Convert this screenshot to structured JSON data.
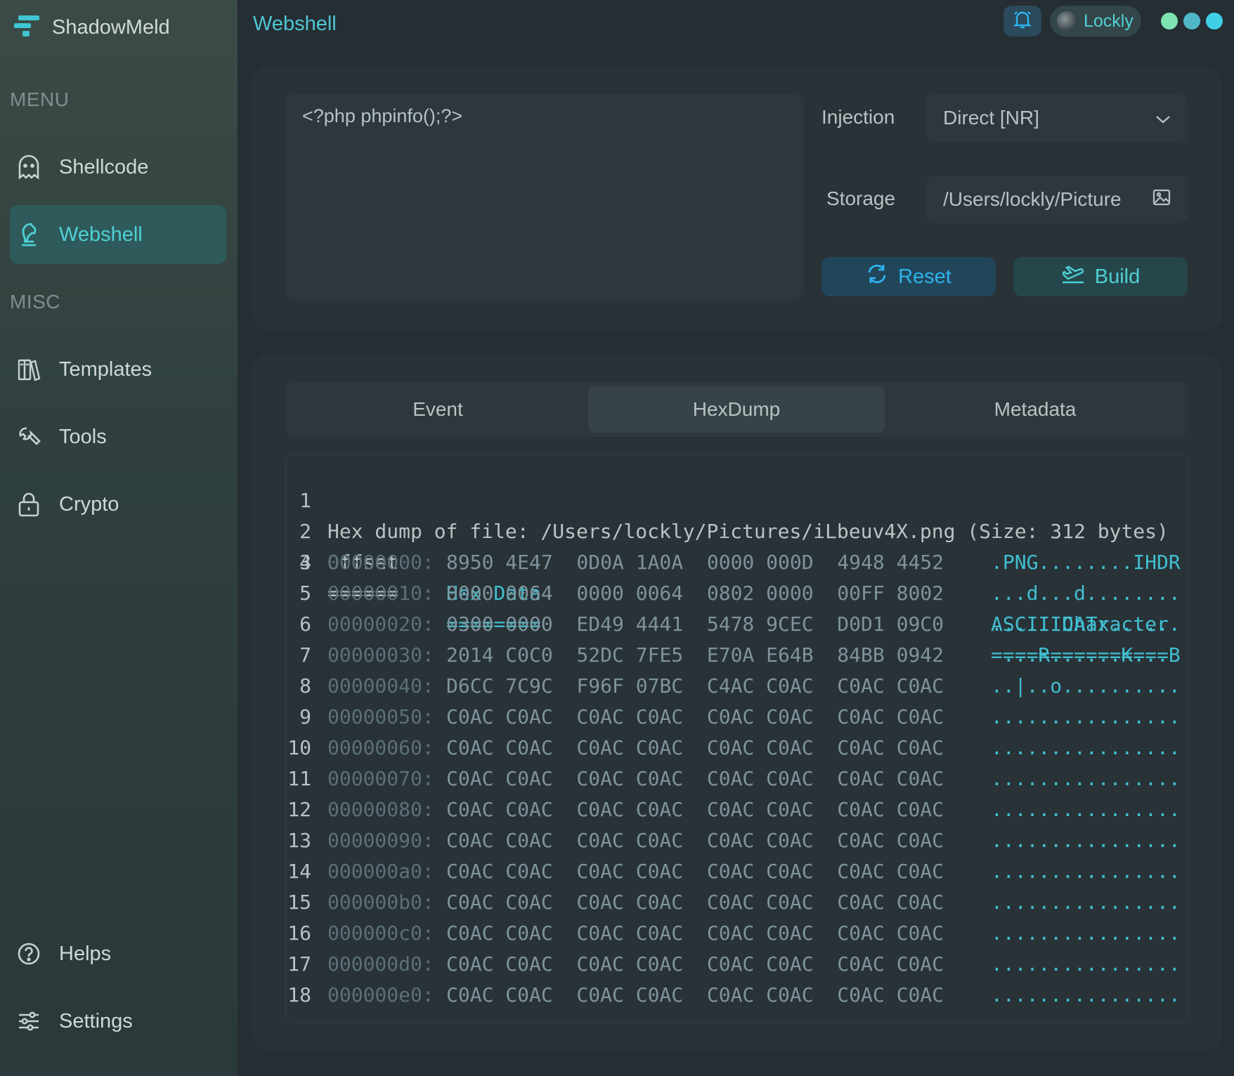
{
  "brand": {
    "name": "ShadowMeld"
  },
  "sidebar": {
    "menu_label": "MENU",
    "misc_label": "MISC",
    "items": [
      {
        "label": "Shellcode",
        "icon": "ghost-icon"
      },
      {
        "label": "Webshell",
        "icon": "chess-knight-icon",
        "active": true
      },
      {
        "label": "Templates",
        "icon": "books-icon"
      },
      {
        "label": "Tools",
        "icon": "wrench-icon"
      },
      {
        "label": "Crypto",
        "icon": "lock-icon"
      },
      {
        "label": "Helps",
        "icon": "help-circle-icon"
      },
      {
        "label": "Settings",
        "icon": "sliders-icon"
      }
    ]
  },
  "header": {
    "title": "Webshell",
    "user_name": "Lockly",
    "dot_colors": [
      "#7ee3b0",
      "#4fb7c8",
      "#3fd0e6"
    ]
  },
  "editor": {
    "code": "<?php phpinfo();?>"
  },
  "form": {
    "injection_label": "Injection",
    "injection_value": "Direct [NR]",
    "storage_label": "Storage",
    "storage_value": "/Users/lockly/Picture"
  },
  "actions": {
    "reset_label": "Reset",
    "build_label": "Build"
  },
  "tabs": [
    {
      "label": "Event"
    },
    {
      "label": "HexDump",
      "active": true
    },
    {
      "label": "Metadata"
    }
  ],
  "hexdump": {
    "header_line": "Hex dump of file: /Users/lockly/Pictures/iLbeuv4X.png (Size: 312 bytes)",
    "col_offset": "Offset",
    "col_hex": "Hex Data",
    "col_ascii": "ASCII Character",
    "sep_offset": "======",
    "sep_hex": "========",
    "sep_ascii": "===============",
    "rows": [
      {
        "offset": "00000000:",
        "hex": "8950 4E47  0D0A 1A0A  0000 000D  4948 4452",
        "ascii": ".PNG........IHDR"
      },
      {
        "offset": "00000010:",
        "hex": "0000 0064  0000 0064  0802 0000  00FF 8002",
        "ascii": "...d...d........"
      },
      {
        "offset": "00000020:",
        "hex": "0300 0000  ED49 4441  5478 9CEC  D0D1 09C0",
        "ascii": ".....IDATx......"
      },
      {
        "offset": "00000030:",
        "hex": "2014 C0C0  52DC 7FE5  E70A E64B  84BB 0942",
        "ascii": " ...R......K...B"
      },
      {
        "offset": "00000040:",
        "hex": "D6CC 7C9C  F96F 07BC  C4AC C0AC  C0AC C0AC",
        "ascii": "..|..o.........."
      },
      {
        "offset": "00000050:",
        "hex": "C0AC C0AC  C0AC C0AC  C0AC C0AC  C0AC C0AC",
        "ascii": "................"
      },
      {
        "offset": "00000060:",
        "hex": "C0AC C0AC  C0AC C0AC  C0AC C0AC  C0AC C0AC",
        "ascii": "................"
      },
      {
        "offset": "00000070:",
        "hex": "C0AC C0AC  C0AC C0AC  C0AC C0AC  C0AC C0AC",
        "ascii": "................"
      },
      {
        "offset": "00000080:",
        "hex": "C0AC C0AC  C0AC C0AC  C0AC C0AC  C0AC C0AC",
        "ascii": "................"
      },
      {
        "offset": "00000090:",
        "hex": "C0AC C0AC  C0AC C0AC  C0AC C0AC  C0AC C0AC",
        "ascii": "................"
      },
      {
        "offset": "000000a0:",
        "hex": "C0AC C0AC  C0AC C0AC  C0AC C0AC  C0AC C0AC",
        "ascii": "................"
      },
      {
        "offset": "000000b0:",
        "hex": "C0AC C0AC  C0AC C0AC  C0AC C0AC  C0AC C0AC",
        "ascii": "................"
      },
      {
        "offset": "000000c0:",
        "hex": "C0AC C0AC  C0AC C0AC  C0AC C0AC  C0AC C0AC",
        "ascii": "................"
      },
      {
        "offset": "000000d0:",
        "hex": "C0AC C0AC  C0AC C0AC  C0AC C0AC  C0AC C0AC",
        "ascii": "................"
      },
      {
        "offset": "000000e0:",
        "hex": "C0AC C0AC  C0AC C0AC  C0AC C0AC  C0AC C0AC",
        "ascii": "................"
      }
    ]
  },
  "colors": {
    "accent": "#4fd0d4",
    "reset_blue": "#2fb4ee",
    "bg": "#252e33"
  }
}
